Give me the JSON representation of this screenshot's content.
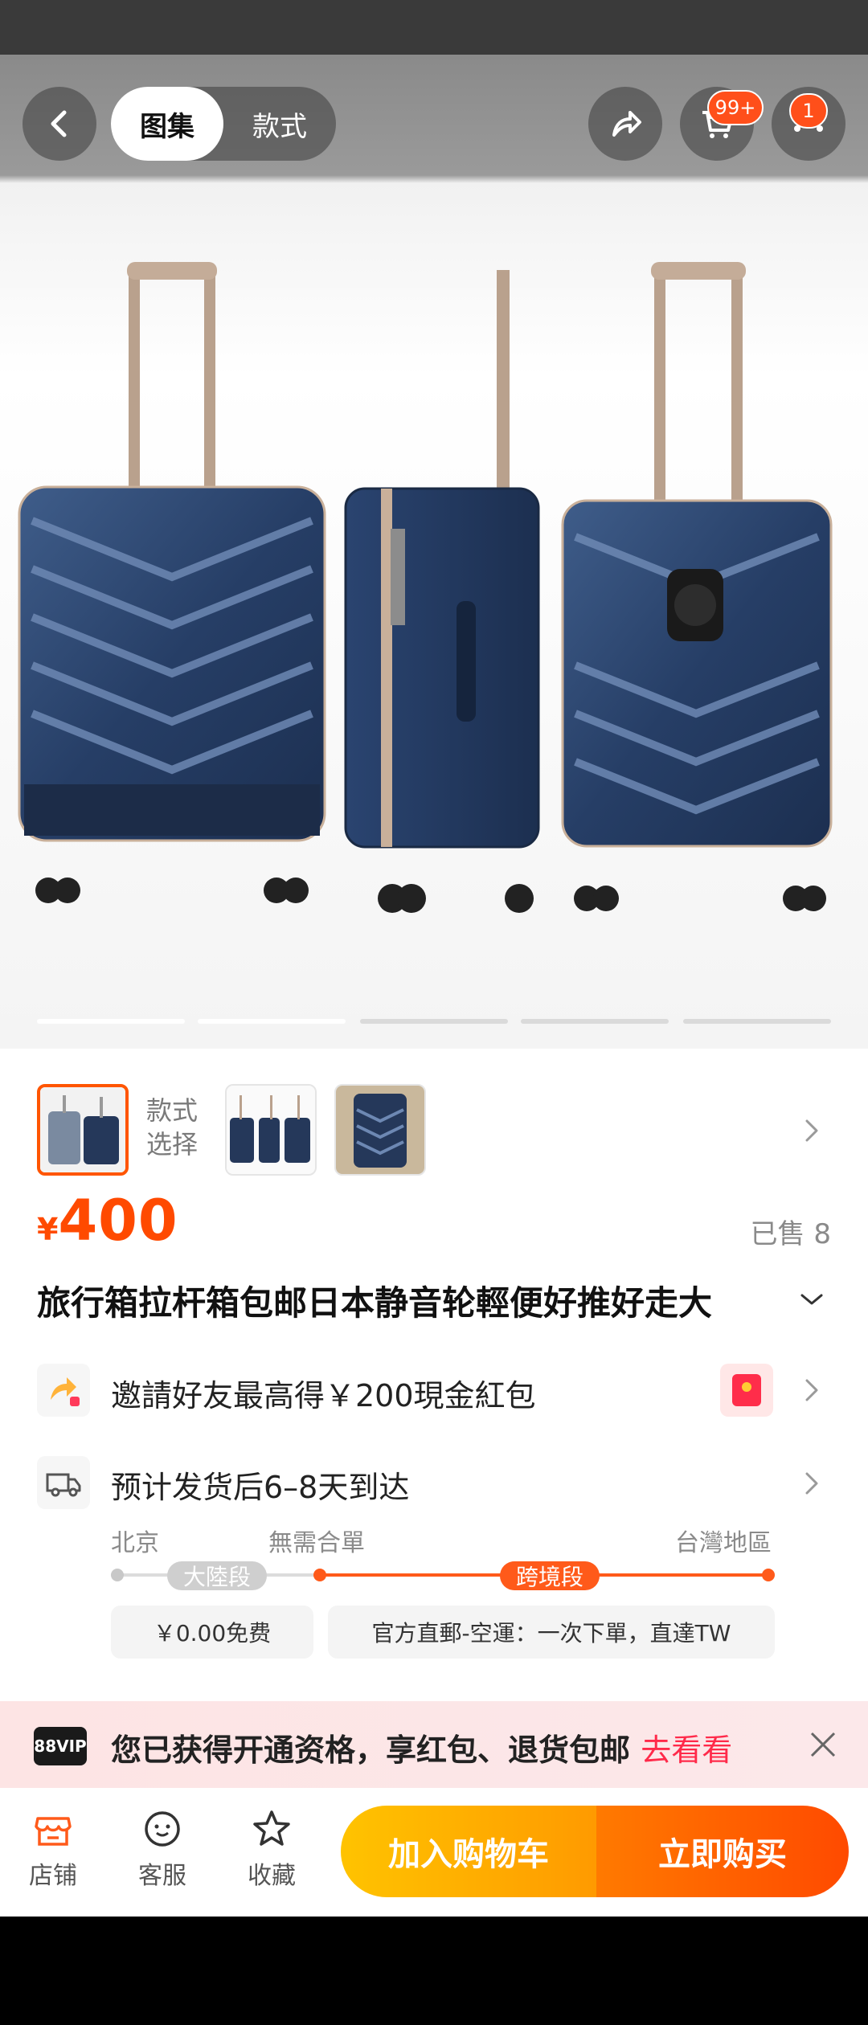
{
  "header": {
    "tabs": [
      {
        "label": "图集",
        "active": true
      },
      {
        "label": "款式",
        "active": false
      }
    ],
    "cart_badge": "99+",
    "more_badge": "1"
  },
  "gallery": {
    "image_description_icon": "suitcase-product-image",
    "slides_total": 5,
    "slide_active": 2
  },
  "variants": {
    "style_label_line1": "款式",
    "style_label_line2": "选择"
  },
  "product": {
    "currency": "¥",
    "price": "400",
    "sold": "已售 8",
    "title": "旅行箱拉杆箱包邮日本静音轮輕便好推好走大"
  },
  "promo": {
    "text": "邀請好友最高得￥200現金紅包"
  },
  "shipping": {
    "text": "预计发货后6–8天到达",
    "origin": "北京",
    "middle": "無需合單",
    "destination": "台灣地區",
    "segment1": "大陸段",
    "segment2": "跨境段",
    "fee1": "￥0.00免费",
    "fee2": "官方直郵-空運：一次下單，直達TW"
  },
  "vip": {
    "logo": "88VIP",
    "text": "您已获得开通资格，享红包、退货包邮",
    "cta": "去看看"
  },
  "bottom": {
    "store": "店铺",
    "service": "客服",
    "favorite": "收藏",
    "add_to_cart": "加入购物车",
    "buy_now": "立即购买"
  },
  "colors": {
    "accent": "#ff4a00",
    "cart_button": "#ffb000",
    "vip_cta": "#ff2a4a"
  }
}
